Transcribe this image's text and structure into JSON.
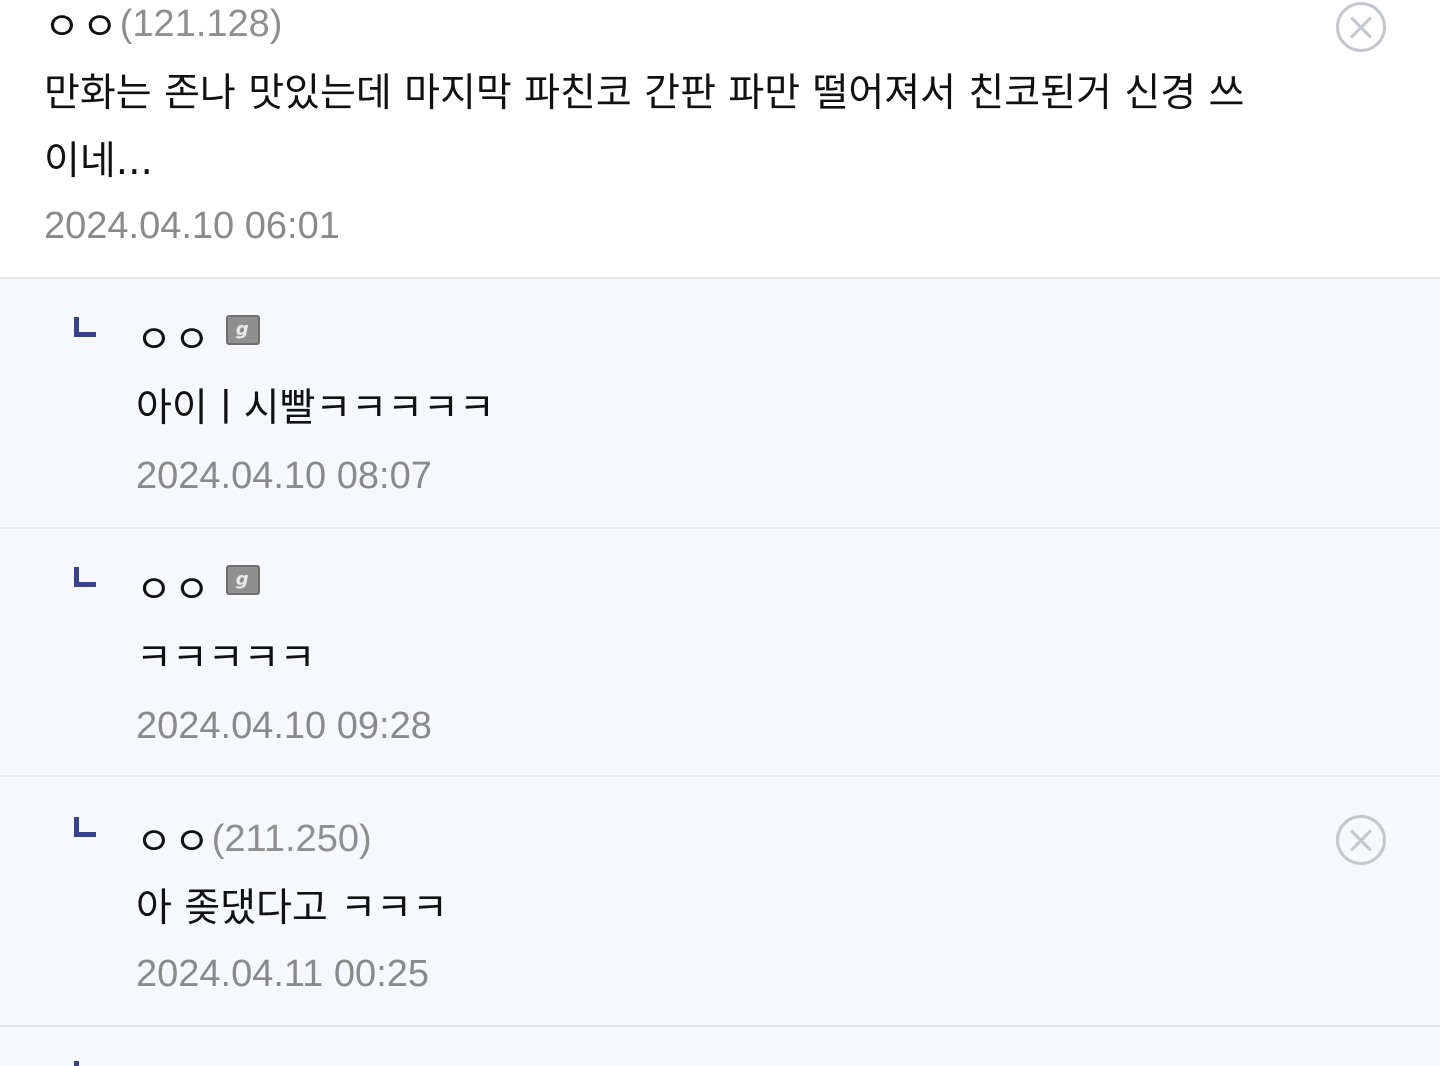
{
  "comments": [
    {
      "nickname": "ㅇㅇ",
      "ip": "(121.128)",
      "text_line1": "만화는 존나 맛있는데 마지막 파친코 간판 파만 떨어져서 친코된거 신경 쓰",
      "text_line2": "이네...",
      "date": "2024.04.10 06:01"
    },
    {
      "nickname": "ㅇㅇ",
      "text": "아이ㅣ시빨ㅋㅋㅋㅋㅋ",
      "date": "2024.04.10 08:07"
    },
    {
      "nickname": "ㅇㅇ",
      "text": "ㅋㅋㅋㅋㅋ",
      "date": "2024.04.10 09:28"
    },
    {
      "nickname": "ㅇㅇ",
      "ip": "(211.250)",
      "text": "아 좆댔다고 ㅋㅋㅋ",
      "date": "2024.04.11 00:25"
    }
  ],
  "icons": {
    "gallog": "gallog-icon",
    "gallog_glyph": "g",
    "delete": "delete-circle-icon",
    "reply": "reply-arrow-icon"
  },
  "colors": {
    "reply_bg": "#f7f8fb",
    "divider": "#e2e5ec",
    "reply_arrow": "#3a428a",
    "meta_text": "#8a8a8a"
  }
}
